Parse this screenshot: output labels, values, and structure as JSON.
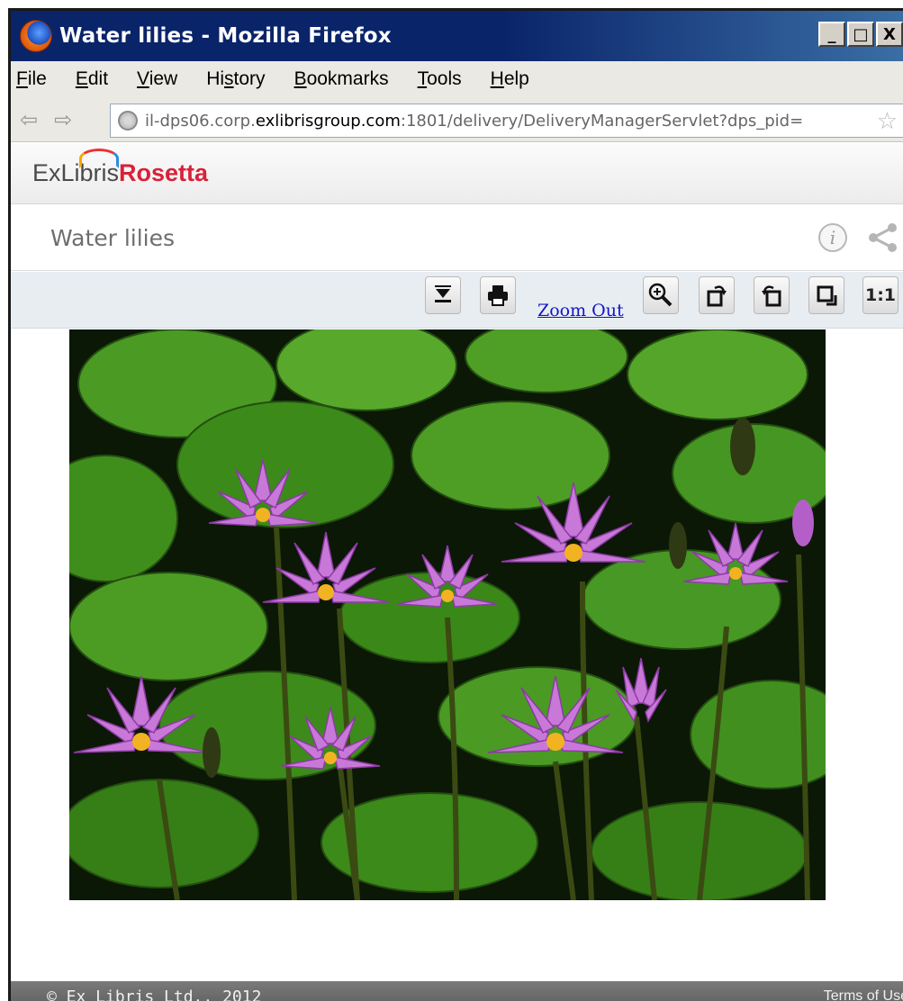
{
  "window": {
    "title": "Water lilies - Mozilla Firefox",
    "controls": {
      "minimize": "_",
      "maximize": "□",
      "close": "X"
    }
  },
  "menu": [
    {
      "accel": "F",
      "rest": "ile"
    },
    {
      "accel": "E",
      "rest": "dit"
    },
    {
      "accel": "V",
      "rest": "iew"
    },
    {
      "pre": "Hi",
      "accel": "s",
      "rest": "tory"
    },
    {
      "accel": "B",
      "rest": "ookmarks"
    },
    {
      "accel": "T",
      "rest": "ools"
    },
    {
      "accel": "H",
      "rest": "elp"
    }
  ],
  "address": {
    "prefix": "il-dps06.corp.",
    "domain": "exlibrisgroup.com",
    "suffix": ":1801/delivery/DeliveryManagerServlet?dps_pid="
  },
  "brand": {
    "exlibris": "ExLibris",
    "rosetta": "Rosetta"
  },
  "page": {
    "title": "Water lilies"
  },
  "toolbar": {
    "zoom_out": "Zoom Out",
    "one_to_one": "1:1"
  },
  "footer": {
    "copyright": "© Ex Libris Ltd., 2012",
    "terms": "Terms of Use"
  },
  "icons": [
    "firefox-logo-icon",
    "back-arrow-icon",
    "forward-arrow-icon",
    "globe-icon",
    "bookmark-star-icon",
    "info-icon",
    "share-icon",
    "download-icon",
    "print-icon",
    "zoom-in-icon",
    "rotate-left-icon",
    "rotate-right-icon",
    "fit-window-icon"
  ],
  "colors": {
    "rosetta_red": "#d8213a",
    "toolbar_bg": "#e8edf2",
    "footer_bg": "#6a6a6a",
    "link": "#1414c8"
  }
}
